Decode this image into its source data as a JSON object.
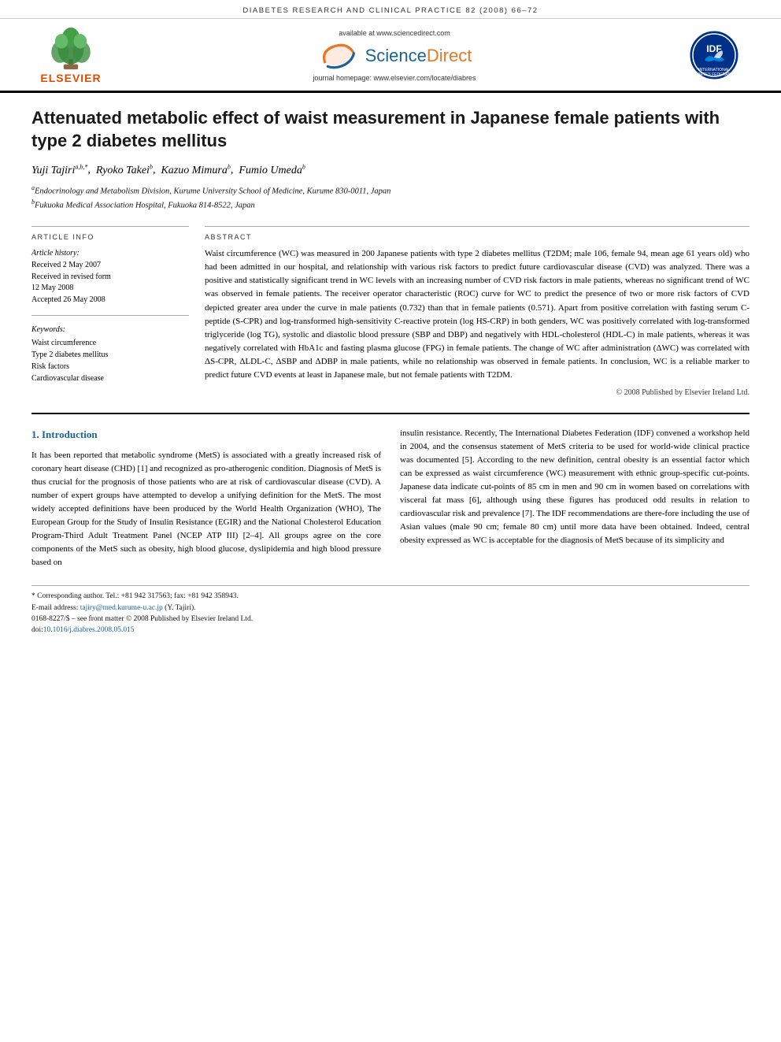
{
  "journal_header": "DIABETES RESEARCH AND CLINICAL PRACTICE 82 (2008) 66–72",
  "logo": {
    "available_text": "available at www.sciencedirect.com",
    "journal_homepage": "journal homepage: www.elsevier.com/locate/diabres",
    "elsevier_text": "ELSEVIER",
    "idf_text": "International Diabetes Federation",
    "sd_text_main": "Science",
    "sd_text_accent": "Direct"
  },
  "article": {
    "title": "Attenuated metabolic effect of waist measurement in Japanese female patients with type 2 diabetes mellitus",
    "authors": [
      {
        "name": "Yuji Tajiri",
        "sup": "a,b,*"
      },
      {
        "name": "Ryoko Takei",
        "sup": "b"
      },
      {
        "name": "Kazuo Mimura",
        "sup": "b"
      },
      {
        "name": "Fumio Umeda",
        "sup": "b"
      }
    ],
    "affiliations": [
      {
        "sup": "a",
        "text": "Endocrinology and Metabolism Division, Kurume University School of Medicine, Kurume 830-0011, Japan"
      },
      {
        "sup": "b",
        "text": "Fukuoka Medical Association Hospital, Fukuoka 814-8522, Japan"
      }
    ]
  },
  "article_info": {
    "section_title": "ARTICLE INFO",
    "history_title": "Article history:",
    "received": "Received 2 May 2007",
    "revised": "Received in revised form\n12 May 2008",
    "accepted": "Accepted 26 May 2008",
    "keywords_title": "Keywords:",
    "keywords": [
      "Waist circumference",
      "Type 2 diabetes mellitus",
      "Risk factors",
      "Cardiovascular disease"
    ]
  },
  "abstract": {
    "section_title": "ABSTRACT",
    "text": "Waist circumference (WC) was measured in 200 Japanese patients with type 2 diabetes mellitus (T2DM; male 106, female 94, mean age 61 years old) who had been admitted in our hospital, and relationship with various risk factors to predict future cardiovascular disease (CVD) was analyzed. There was a positive and statistically significant trend in WC levels with an increasing number of CVD risk factors in male patients, whereas no significant trend of WC was observed in female patients. The receiver operator characteristic (ROC) curve for WC to predict the presence of two or more risk factors of CVD depicted greater area under the curve in male patients (0.732) than that in female patients (0.571). Apart from positive correlation with fasting serum C-peptide (S-CPR) and log-transformed high-sensitivity C-reactive protein (log HS-CRP) in both genders, WC was positively correlated with log-transformed triglyceride (log TG), systolic and diastolic blood pressure (SBP and DBP) and negatively with HDL-cholesterol (HDL-C) in male patients, whereas it was negatively correlated with HbA1c and fasting plasma glucose (FPG) in female patients. The change of WC after administration (ΔWC) was correlated with ΔS-CPR, ΔLDL-C, ΔSBP and ΔDBP in male patients, while no relationship was observed in female patients. In conclusion, WC is a reliable marker to predict future CVD events at least in Japanese male, but not female patients with T2DM.",
    "copyright": "© 2008 Published by Elsevier Ireland Ltd."
  },
  "introduction": {
    "number": "1.",
    "title": "Introduction",
    "col1_text": "It has been reported that metabolic syndrome (MetS) is associated with a greatly increased risk of coronary heart disease (CHD) [1] and recognized as pro-atherogenic condition. Diagnosis of MetS is thus crucial for the prognosis of those patients who are at risk of cardiovascular disease (CVD). A number of expert groups have attempted to develop a unifying definition for the MetS. The most widely accepted definitions have been produced by the World Health Organization (WHO), The European Group for the Study of Insulin Resistance (EGIR) and the National Cholesterol Education Program-Third Adult Treatment Panel (NCEP ATP III) [2–4]. All groups agree on the core components of the MetS such as obesity, high blood glucose, dyslipidemia and high blood pressure based on",
    "col2_text": "insulin resistance. Recently, The International Diabetes Federation (IDF) convened a workshop held in 2004, and the consensus statement of MetS criteria to be used for world-wide clinical practice was documented [5]. According to the new definition, central obesity is an essential factor which can be expressed as waist circumference (WC) measurement with ethnic group-specific cut-points. Japanese data indicate cut-points of 85 cm in men and 90 cm in women based on correlations with visceral fat mass [6], although using these figures has produced odd results in relation to cardiovascular risk and prevalence [7]. The IDF recommendations are there-fore including the use of Asian values (male 90 cm; female 80 cm) until more data have been obtained.\n\nIndeed, central obesity expressed as WC is acceptable for the diagnosis of MetS because of its simplicity and"
  },
  "footnotes": {
    "corresponding": "* Corresponding author. Tel.: +81 942 317563; fax: +81 942 358943.",
    "email": "E-mail address: tajiry@med.kurume-u.ac.jp (Y. Tajiri).",
    "issn": "0168-8227/$ – see front matter © 2008 Published by Elsevier Ireland Ltd.",
    "doi": "doi:10.1016/j.diabres.2008.05.015"
  }
}
